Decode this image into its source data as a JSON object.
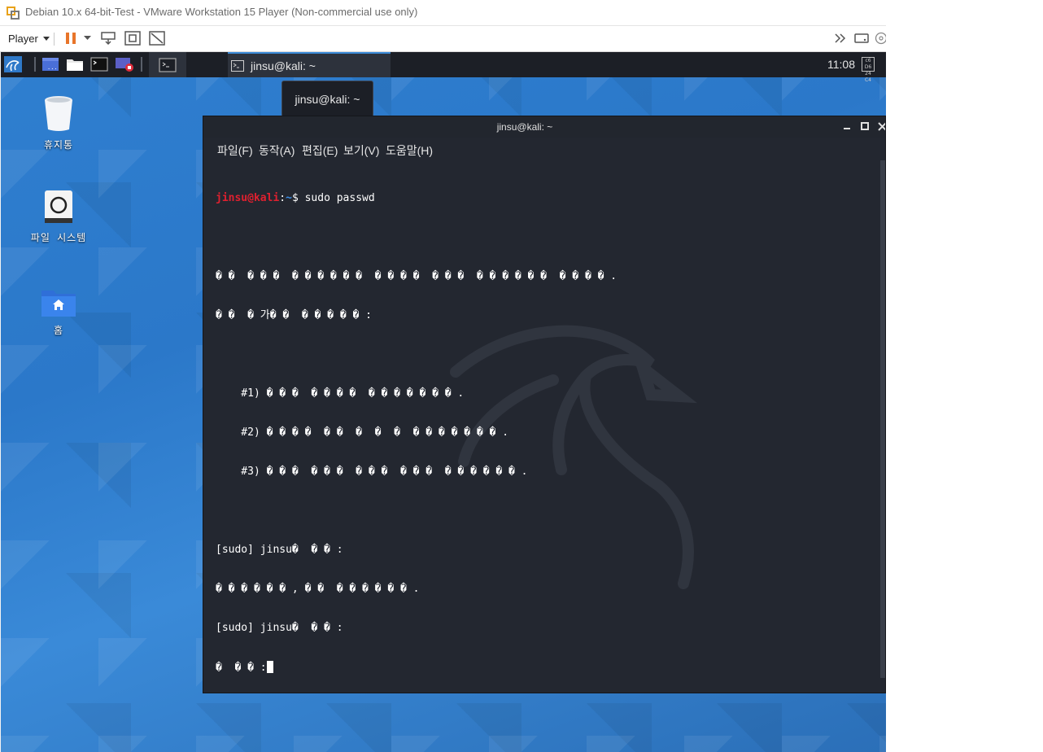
{
  "vmware": {
    "window_title": "Debian 10.x 64-bit-Test - VMware Workstation 15 Player (Non-commercial use only)",
    "player_menu_label": "Player"
  },
  "guest": {
    "panel": {
      "active_task_label": "jinsu@kali: ~",
      "clock": "11:08",
      "tray_text": "c6 D6 24 C4"
    },
    "tooltip": "jinsu@kali: ~",
    "desktop_icons": [
      {
        "label": "휴지통",
        "icon": "trash-icon"
      },
      {
        "label": "파일 시스템",
        "icon": "drive-icon"
      },
      {
        "label": "홈",
        "icon": "home-folder-icon"
      }
    ]
  },
  "terminal": {
    "title": "jinsu@kali: ~",
    "menus": [
      "파일(F)",
      "동작(A)",
      "편집(E)",
      "보기(V)",
      "도움말(H)"
    ],
    "prompt_user": "jinsu@kali",
    "prompt_sep": ":",
    "prompt_path": "~",
    "prompt_symbol": "$",
    "command": " sudo passwd",
    "output_lines": [
      "",
      "� �  � � �  � � � � � �  � � � �  � � �  � � � � � �  � � � � .",
      "� �  � 가� �  � � � � � :",
      "",
      "    #1) � � �  � � � �  � � � � � � � .",
      "    #2) � � � �  � �  �  �  �  � � � � � � � .",
      "    #3) � � �  � � �  � � �  � � �  � � � � � � .",
      "",
      "[sudo] jinsu�  � � :",
      "� � � � � � , � �  � � � � � � .",
      "[sudo] jinsu�  � � :"
    ],
    "last_line": "�  � � :"
  },
  "colors": {
    "prompt_user": "#e0202f",
    "prompt_path": "#3c8fe8",
    "terminal_bg": "#232730",
    "panel_bg": "#1c1f26",
    "vm_pause_accent": "#e8752a"
  }
}
